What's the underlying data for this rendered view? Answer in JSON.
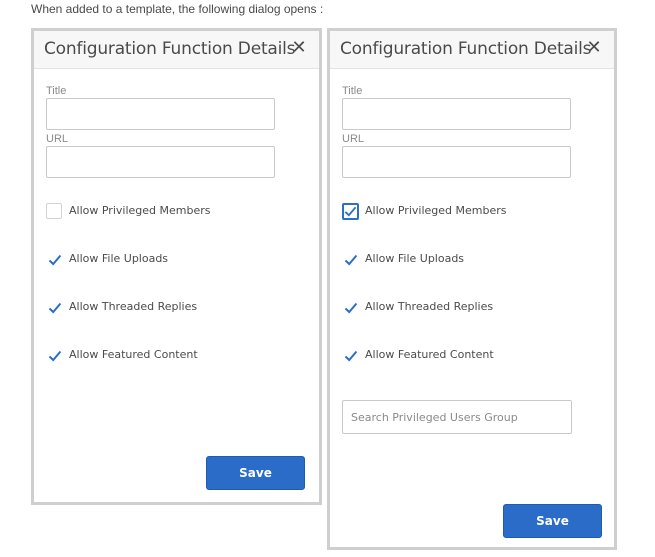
{
  "intro_text": "When added to a template, the following dialog opens :",
  "dialogs": [
    {
      "title": "Configuration Function Details",
      "close_glyph": "✕",
      "title_field_label": "Title",
      "title_value": "",
      "url_field_label": "URL",
      "url_value": "",
      "checkboxes": [
        {
          "label": "Allow Privileged Members",
          "checked": false
        },
        {
          "label": "Allow File Uploads",
          "checked": true
        },
        {
          "label": "Allow Threaded Replies",
          "checked": true
        },
        {
          "label": "Allow Featured Content",
          "checked": true
        }
      ],
      "save_label": "Save"
    },
    {
      "title": "Configuration Function Details",
      "close_glyph": "✕",
      "title_field_label": "Title",
      "title_value": "",
      "url_field_label": "URL",
      "url_value": "",
      "checkboxes": [
        {
          "label": "Allow Privileged Members",
          "checked": true,
          "focused": true
        },
        {
          "label": "Allow File Uploads",
          "checked": true
        },
        {
          "label": "Allow Threaded Replies",
          "checked": true
        },
        {
          "label": "Allow Featured Content",
          "checked": true
        }
      ],
      "search_placeholder": "Search Privileged Users Group",
      "save_label": "Save"
    }
  ],
  "colors": {
    "accent": "#2a6cc7",
    "checkmark": "#2b6fc7",
    "dialog_border": "#cfcfcf",
    "header_bg": "#f7f7f7"
  },
  "icons": {
    "close": "close-icon",
    "checkbox_checked": "checkmark-icon"
  }
}
